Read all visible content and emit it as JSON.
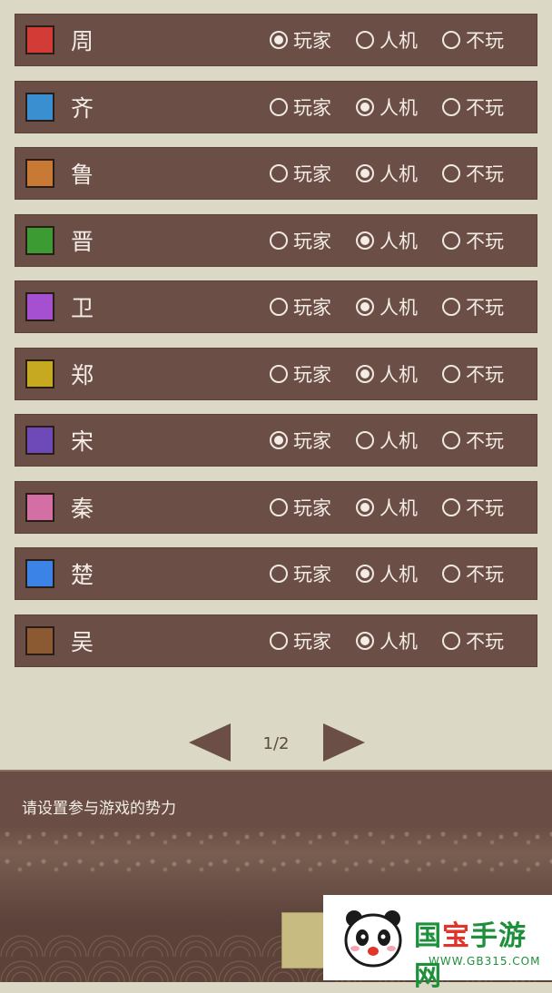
{
  "factions": [
    {
      "name": "周",
      "color": "#d33b36",
      "selected": "player"
    },
    {
      "name": "齐",
      "color": "#3a8fd0",
      "selected": "ai"
    },
    {
      "name": "鲁",
      "color": "#c87a35",
      "selected": "ai"
    },
    {
      "name": "晋",
      "color": "#3c9c33",
      "selected": "ai"
    },
    {
      "name": "卫",
      "color": "#a54fd1",
      "selected": "ai"
    },
    {
      "name": "郑",
      "color": "#c7a821",
      "selected": "ai"
    },
    {
      "name": "宋",
      "color": "#6e4ab8",
      "selected": "player"
    },
    {
      "name": "秦",
      "color": "#d46fa6",
      "selected": "ai"
    },
    {
      "name": "楚",
      "color": "#3b83e6",
      "selected": "ai"
    },
    {
      "name": "吴",
      "color": "#8b5a33",
      "selected": "ai"
    }
  ],
  "options": {
    "player": "玩家",
    "ai": "人机",
    "none": "不玩"
  },
  "pager": {
    "text": "1/2"
  },
  "footer": {
    "hint": "请设置参与游戏的势力"
  },
  "watermark": {
    "title_a": "国",
    "title_b": "宝",
    "title_c": "手游网",
    "url": "WWW.GB315.COM"
  },
  "colors": {
    "row_bg": "#6b4f47",
    "page_bg": "#dcd8c6",
    "confirm": "#c8bb82"
  }
}
